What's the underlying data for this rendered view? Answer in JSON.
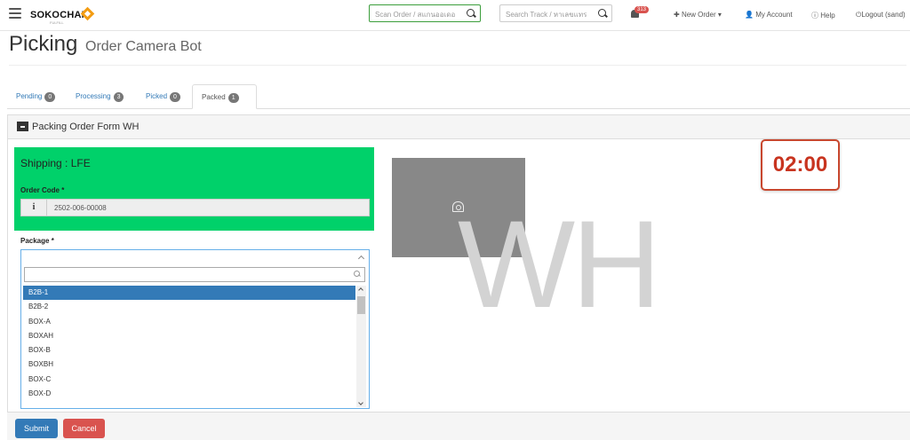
{
  "brand": {
    "name": "SOKOCHAN",
    "sub": "FULFILL"
  },
  "header": {
    "scan_placeholder": "Scan Order / สแกนออเดอ",
    "track_placeholder": "Search Track / หาเลขแทร",
    "notif_count": "313",
    "new_order": "New Order",
    "my_account": "My Account",
    "help": "Help",
    "logout": "Logout (sand)"
  },
  "page": {
    "title": "Picking",
    "subtitle": "Order Camera Bot"
  },
  "tabs": [
    {
      "label": "Pending",
      "count": "0"
    },
    {
      "label": "Processing",
      "count": "3"
    },
    {
      "label": "Picked",
      "count": "0"
    },
    {
      "label": "Packed",
      "count": "1"
    }
  ],
  "form": {
    "title": "Packing Order Form WH",
    "shipping": "Shipping : LFE",
    "order_code_label": "Order Code *",
    "order_code": "2502-006-00008",
    "package_label": "Package *",
    "package_options": [
      "B2B-1",
      "B2B-2",
      "BOX-A",
      "BOXAH",
      "BOX-B",
      "BOXBH",
      "BOX-C",
      "BOX-D"
    ],
    "selected_index": 0,
    "submit": "Submit",
    "cancel": "Cancel"
  },
  "watermark": "WH",
  "timer": "02:00",
  "colors": {
    "accent": "#337ab7",
    "shipping_bg": "#00d16a",
    "danger": "#d9534f",
    "timer": "#c8341f"
  }
}
